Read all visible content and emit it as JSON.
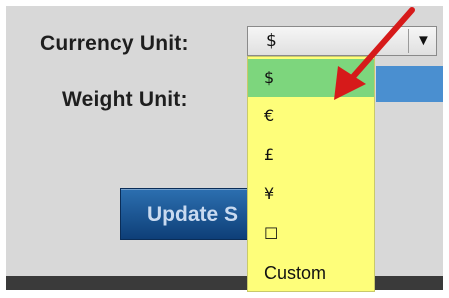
{
  "form": {
    "currency_label": "Currency Unit:",
    "weight_label": "Weight Unit:",
    "update_button": "Update S"
  },
  "currency_select": {
    "selected": "$",
    "arrow": "▼",
    "options": [
      "$",
      "€",
      "£",
      "¥",
      "☐",
      "Custom"
    ]
  },
  "colors": {
    "dropdown_bg": "#fefe7a",
    "selected_bg": "#7dd67d",
    "button": "#1b4f8c",
    "annotation_arrow": "#d61a1a"
  }
}
